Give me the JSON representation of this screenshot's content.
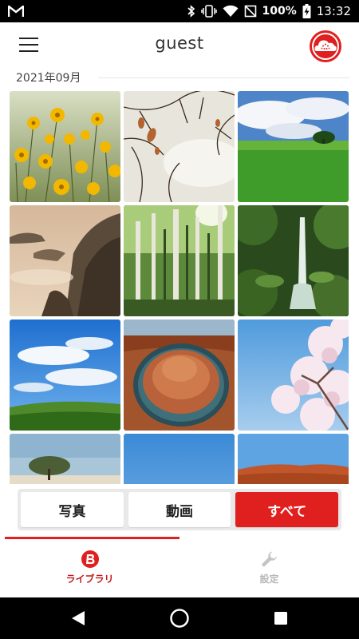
{
  "status_bar": {
    "app_icon": "gmail-icon",
    "icons": [
      "bluetooth-icon",
      "vibrate-icon",
      "wifi-icon",
      "no-sim-icon",
      "battery-charging-icon"
    ],
    "battery": "100%",
    "time": "13:32"
  },
  "header": {
    "title": "guest",
    "menu_icon": "hamburger-icon",
    "cloud_icon": "cloud-account-icon"
  },
  "library": {
    "date_label": "2021年09月",
    "photos": [
      {
        "name": "yellow-flowers"
      },
      {
        "name": "autumn-branches"
      },
      {
        "name": "green-field-sky"
      },
      {
        "name": "misty-cliffs"
      },
      {
        "name": "birch-forest"
      },
      {
        "name": "forest-waterfall"
      },
      {
        "name": "blue-sky-hill"
      },
      {
        "name": "horseshoe-bend"
      },
      {
        "name": "cherry-blossom"
      },
      {
        "name": "beach-tree"
      },
      {
        "name": "clear-sky"
      },
      {
        "name": "autumn-hill"
      }
    ]
  },
  "filters": {
    "photos": "写真",
    "videos": "動画",
    "all": "すべて",
    "active": "all"
  },
  "tabs": {
    "library": "ライブラリ",
    "settings": "設定"
  },
  "colors": {
    "accent": "#e01f1f",
    "tab_active": "#c41a1a",
    "tab_inactive": "#b8b8b8"
  }
}
